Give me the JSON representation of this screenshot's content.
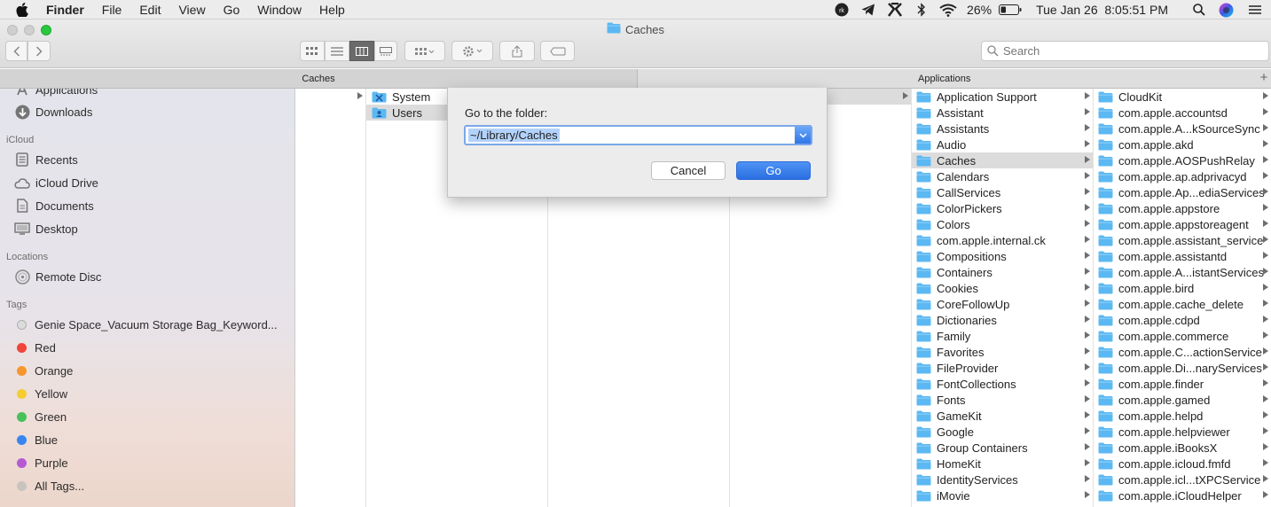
{
  "menubar": {
    "items": [
      "Finder",
      "File",
      "Edit",
      "View",
      "Go",
      "Window",
      "Help"
    ],
    "battery": "26%",
    "clock": "Tue Jan 26  8:05:51 PM",
    "status_icons": [
      "app-badge-icon",
      "telegram-icon",
      "app-icon",
      "bluetooth-icon",
      "wifi-icon",
      "battery-icon",
      "search-icon",
      "siri-icon",
      "control-center-icon"
    ]
  },
  "window": {
    "title": "Caches",
    "search_placeholder": "Search"
  },
  "pathbar": {
    "left": "Caches",
    "right": "Applications"
  },
  "sidebar": {
    "top_items": [
      {
        "label": "Applications",
        "icon": "applications-icon"
      },
      {
        "label": "Downloads",
        "icon": "downloads-icon"
      }
    ],
    "icloud_header": "iCloud",
    "icloud_items": [
      {
        "label": "Recents",
        "icon": "recents-icon"
      },
      {
        "label": "iCloud Drive",
        "icon": "cloud-icon"
      },
      {
        "label": "Documents",
        "icon": "document-icon"
      },
      {
        "label": "Desktop",
        "icon": "desktop-icon"
      }
    ],
    "locations_header": "Locations",
    "locations_items": [
      {
        "label": "Remote Disc",
        "icon": "disc-icon"
      }
    ],
    "tags_header": "Tags",
    "tags": [
      {
        "label": "Genie Space_Vacuum Storage Bag_Keyword...",
        "color": "#d8d8d8"
      },
      {
        "label": "Red",
        "color": "#f0453a"
      },
      {
        "label": "Orange",
        "color": "#f7962d"
      },
      {
        "label": "Yellow",
        "color": "#f6cd31"
      },
      {
        "label": "Green",
        "color": "#47c15a"
      },
      {
        "label": "Blue",
        "color": "#3a86f0"
      },
      {
        "label": "Purple",
        "color": "#b65ad4"
      },
      {
        "label": "All Tags...",
        "color": "#c9c3c0"
      }
    ]
  },
  "column1": {
    "items": [
      "System",
      "Users"
    ]
  },
  "column4": {
    "items": [
      "Application Support",
      "Assistant",
      "Assistants",
      "Audio",
      "Caches",
      "Calendars",
      "CallServices",
      "ColorPickers",
      "Colors",
      "com.apple.internal.ck",
      "Compositions",
      "Containers",
      "Cookies",
      "CoreFollowUp",
      "Dictionaries",
      "Family",
      "Favorites",
      "FileProvider",
      "FontCollections",
      "Fonts",
      "GameKit",
      "Google",
      "Group Containers",
      "HomeKit",
      "IdentityServices",
      "iMovie"
    ],
    "selected": "Caches"
  },
  "column5": {
    "items": [
      "CloudKit",
      "com.apple.accountsd",
      "com.apple.A...kSourceSync",
      "com.apple.akd",
      "com.apple.AOSPushRelay",
      "com.apple.ap.adprivacyd",
      "com.apple.Ap...ediaServices",
      "com.apple.appstore",
      "com.apple.appstoreagent",
      "com.apple.assistant_service",
      "com.apple.assistantd",
      "com.apple.A...istantServices",
      "com.apple.bird",
      "com.apple.cache_delete",
      "com.apple.cdpd",
      "com.apple.commerce",
      "com.apple.C...actionService",
      "com.apple.Di...naryServices",
      "com.apple.finder",
      "com.apple.gamed",
      "com.apple.helpd",
      "com.apple.helpviewer",
      "com.apple.iBooksX",
      "com.apple.icloud.fmfd",
      "com.apple.icl...tXPCService",
      "com.apple.iCloudHelper"
    ]
  },
  "dialog": {
    "label": "Go to the folder:",
    "path_value": "~/Library/Caches",
    "cancel_label": "Cancel",
    "go_label": "Go"
  },
  "colors": {
    "folder_blue": "#5cb8f2",
    "accent_blue": "#2f7be9"
  }
}
